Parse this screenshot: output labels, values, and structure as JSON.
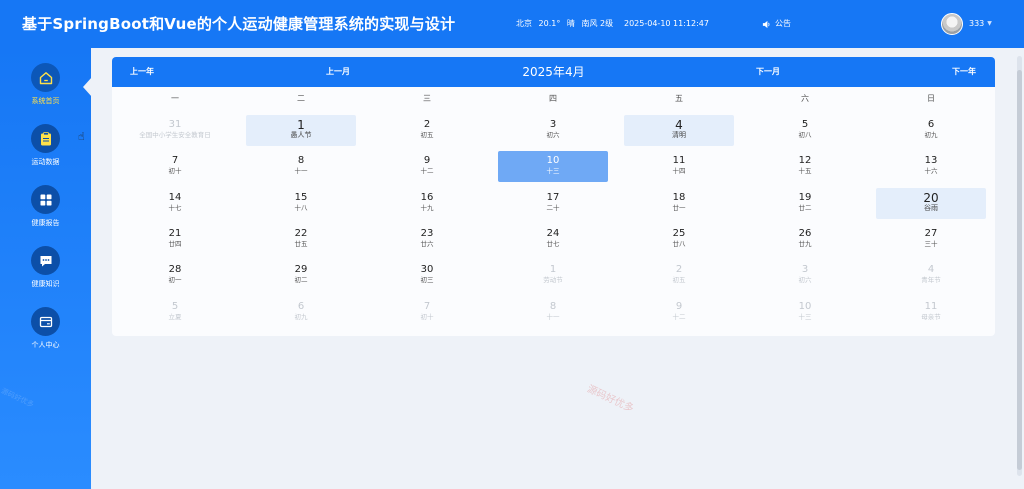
{
  "header": {
    "title": "基于SpringBoot和Vue的个人运动健康管理系统的实现与设计",
    "weather": {
      "city": "北京",
      "temp": "20.1°",
      "condition": "晴",
      "wind": "南风 2级"
    },
    "datetime": "2025-04-10 11:12:47",
    "notice_label": "公告",
    "username": "333"
  },
  "sidebar": {
    "items": [
      {
        "label": "系统首页",
        "icon": "home-icon",
        "active": true
      },
      {
        "label": "运动数据",
        "icon": "clipboard-icon",
        "active": false
      },
      {
        "label": "健康报告",
        "icon": "grid-icon",
        "active": false
      },
      {
        "label": "健康知识",
        "icon": "chat-icon",
        "active": false
      },
      {
        "label": "个人中心",
        "icon": "card-icon",
        "active": false
      }
    ]
  },
  "calendar": {
    "prev_year": "上一年",
    "prev_month": "上一月",
    "title": "2025年4月",
    "next_month": "下一月",
    "next_year": "下一年",
    "weekdays": [
      "一",
      "二",
      "三",
      "四",
      "五",
      "六",
      "日"
    ],
    "weeks": [
      [
        {
          "d": "31",
          "s": "全国中小学生安全教育日",
          "t": "other"
        },
        {
          "d": "1",
          "s": "愚人节",
          "t": "festival"
        },
        {
          "d": "2",
          "s": "初五"
        },
        {
          "d": "3",
          "s": "初六"
        },
        {
          "d": "4",
          "s": "清明",
          "t": "festival"
        },
        {
          "d": "5",
          "s": "初八"
        },
        {
          "d": "6",
          "s": "初九"
        }
      ],
      [
        {
          "d": "7",
          "s": "初十"
        },
        {
          "d": "8",
          "s": "十一"
        },
        {
          "d": "9",
          "s": "十二"
        },
        {
          "d": "10",
          "s": "十三",
          "t": "selected"
        },
        {
          "d": "11",
          "s": "十四"
        },
        {
          "d": "12",
          "s": "十五"
        },
        {
          "d": "13",
          "s": "十六"
        }
      ],
      [
        {
          "d": "14",
          "s": "十七"
        },
        {
          "d": "15",
          "s": "十八"
        },
        {
          "d": "16",
          "s": "十九"
        },
        {
          "d": "17",
          "s": "二十"
        },
        {
          "d": "18",
          "s": "廿一"
        },
        {
          "d": "19",
          "s": "廿二"
        },
        {
          "d": "20",
          "s": "谷雨",
          "t": "festival"
        }
      ],
      [
        {
          "d": "21",
          "s": "廿四"
        },
        {
          "d": "22",
          "s": "廿五"
        },
        {
          "d": "23",
          "s": "廿六"
        },
        {
          "d": "24",
          "s": "廿七"
        },
        {
          "d": "25",
          "s": "廿八"
        },
        {
          "d": "26",
          "s": "廿九"
        },
        {
          "d": "27",
          "s": "三十"
        }
      ],
      [
        {
          "d": "28",
          "s": "初一"
        },
        {
          "d": "29",
          "s": "初二"
        },
        {
          "d": "30",
          "s": "初三"
        },
        {
          "d": "1",
          "s": "劳动节",
          "t": "other"
        },
        {
          "d": "2",
          "s": "初五",
          "t": "other"
        },
        {
          "d": "3",
          "s": "初六",
          "t": "other"
        },
        {
          "d": "4",
          "s": "青年节",
          "t": "other"
        }
      ],
      [
        {
          "d": "5",
          "s": "立夏",
          "t": "other"
        },
        {
          "d": "6",
          "s": "初九",
          "t": "other"
        },
        {
          "d": "7",
          "s": "初十",
          "t": "other"
        },
        {
          "d": "8",
          "s": "十一",
          "t": "other"
        },
        {
          "d": "9",
          "s": "十二",
          "t": "other"
        },
        {
          "d": "10",
          "s": "十三",
          "t": "other"
        },
        {
          "d": "11",
          "s": "母亲节",
          "t": "other"
        }
      ]
    ]
  },
  "watermark": "源码好优多",
  "colors": {
    "primary": "#1677f5",
    "selected": "#6fa9f5",
    "festival": "#e4eefb",
    "active_label": "#ffe14a"
  }
}
